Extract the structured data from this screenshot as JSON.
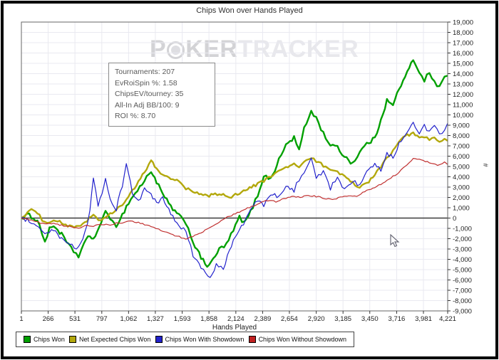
{
  "window": {
    "title": "Chips Won over Hands Played"
  },
  "watermark": {
    "part1": "P",
    "part2": "KER",
    "part3": "TRACKER",
    "chip_icon": "poker-chip"
  },
  "stats_box": {
    "lines": [
      "Tournaments: 207",
      "EvRoiSpin %: 1.58",
      "ChipsEV/tourney: 35",
      "All-In Adj BB/100: 9",
      "ROI %: 8.70"
    ]
  },
  "axes": {
    "x_title": "Hands Played",
    "y_unit_label": "#",
    "grid_color": "#e9e9f0",
    "zero_line_color": "#3c3c3c",
    "border_color": "#666666"
  },
  "legend": {
    "items": [
      {
        "label": "Chips Won",
        "color": "#00a000"
      },
      {
        "label": "Net Expected Chips Won",
        "color": "#b3a80c"
      },
      {
        "label": "Chips Won With Showdown",
        "color": "#2222cc"
      },
      {
        "label": "Chips Won Without Showdown",
        "color": "#c02020"
      }
    ]
  },
  "chart_data": {
    "type": "line",
    "title": "Chips Won over Hands Played",
    "xlabel": "Hands Played",
    "ylabel": "#",
    "xlim": [
      1,
      4221
    ],
    "ylim": [
      -9000,
      19000
    ],
    "y_step": 1000,
    "grid": true,
    "legend_position": "bottom",
    "x_ticks": [
      1,
      266,
      531,
      797,
      1062,
      1327,
      1593,
      1858,
      2124,
      2389,
      2654,
      2920,
      3185,
      3450,
      3716,
      3981,
      4221
    ],
    "series": [
      {
        "name": "Chips Won",
        "color": "#00a000",
        "width": 2.4,
        "points": [
          [
            1,
            0
          ],
          [
            60,
            300
          ],
          [
            120,
            100
          ],
          [
            180,
            -600
          ],
          [
            234,
            -2300
          ],
          [
            280,
            -1100
          ],
          [
            320,
            -700
          ],
          [
            400,
            -1600
          ],
          [
            470,
            -2700
          ],
          [
            567,
            -3700
          ],
          [
            620,
            -2500
          ],
          [
            680,
            -1700
          ],
          [
            714,
            -2000
          ],
          [
            770,
            -1100
          ],
          [
            834,
            900
          ],
          [
            880,
            -300
          ],
          [
            940,
            -700
          ],
          [
            1000,
            300
          ],
          [
            1062,
            1500
          ],
          [
            1150,
            2700
          ],
          [
            1220,
            3600
          ],
          [
            1285,
            4600
          ],
          [
            1340,
            3500
          ],
          [
            1400,
            2300
          ],
          [
            1480,
            1100
          ],
          [
            1560,
            200
          ],
          [
            1630,
            -400
          ],
          [
            1700,
            -2300
          ],
          [
            1780,
            -3900
          ],
          [
            1840,
            -4600
          ],
          [
            1900,
            -4100
          ],
          [
            1960,
            -3000
          ],
          [
            2030,
            -2600
          ],
          [
            2100,
            -1200
          ],
          [
            2160,
            100
          ],
          [
            2210,
            -500
          ],
          [
            2270,
            600
          ],
          [
            2340,
            2200
          ],
          [
            2400,
            4100
          ],
          [
            2470,
            3800
          ],
          [
            2550,
            5600
          ],
          [
            2620,
            7100
          ],
          [
            2700,
            7800
          ],
          [
            2750,
            6600
          ],
          [
            2800,
            8600
          ],
          [
            2870,
            10400
          ],
          [
            2920,
            9700
          ],
          [
            2990,
            8200
          ],
          [
            3060,
            7100
          ],
          [
            3130,
            6800
          ],
          [
            3200,
            6000
          ],
          [
            3280,
            5300
          ],
          [
            3350,
            6400
          ],
          [
            3420,
            7200
          ],
          [
            3500,
            7700
          ],
          [
            3560,
            9600
          ],
          [
            3620,
            11400
          ],
          [
            3680,
            10900
          ],
          [
            3740,
            12600
          ],
          [
            3800,
            13600
          ],
          [
            3880,
            15400
          ],
          [
            3940,
            14200
          ],
          [
            3990,
            13400
          ],
          [
            4040,
            14100
          ],
          [
            4090,
            13100
          ],
          [
            4140,
            12800
          ],
          [
            4190,
            13600
          ],
          [
            4221,
            13800
          ]
        ]
      },
      {
        "name": "Net Expected Chips Won",
        "color": "#b3a80c",
        "width": 2.4,
        "points": [
          [
            1,
            0
          ],
          [
            100,
            900
          ],
          [
            180,
            200
          ],
          [
            234,
            -500
          ],
          [
            320,
            -100
          ],
          [
            400,
            -500
          ],
          [
            480,
            -800
          ],
          [
            567,
            -900
          ],
          [
            650,
            -200
          ],
          [
            714,
            300
          ],
          [
            790,
            -300
          ],
          [
            860,
            200
          ],
          [
            940,
            800
          ],
          [
            1020,
            1500
          ],
          [
            1100,
            2600
          ],
          [
            1180,
            3800
          ],
          [
            1240,
            4800
          ],
          [
            1285,
            5600
          ],
          [
            1340,
            4700
          ],
          [
            1400,
            4200
          ],
          [
            1480,
            3900
          ],
          [
            1560,
            3500
          ],
          [
            1630,
            2900
          ],
          [
            1700,
            2500
          ],
          [
            1780,
            2300
          ],
          [
            1840,
            2100
          ],
          [
            1920,
            2400
          ],
          [
            2000,
            2200
          ],
          [
            2060,
            2000
          ],
          [
            2120,
            2300
          ],
          [
            2200,
            2600
          ],
          [
            2280,
            3000
          ],
          [
            2340,
            3300
          ],
          [
            2400,
            3600
          ],
          [
            2470,
            4100
          ],
          [
            2550,
            4500
          ],
          [
            2620,
            4900
          ],
          [
            2700,
            5200
          ],
          [
            2750,
            5000
          ],
          [
            2800,
            5400
          ],
          [
            2870,
            5800
          ],
          [
            2920,
            5500
          ],
          [
            2990,
            5100
          ],
          [
            3060,
            4800
          ],
          [
            3130,
            4400
          ],
          [
            3200,
            4000
          ],
          [
            3280,
            3400
          ],
          [
            3350,
            3000
          ],
          [
            3420,
            3300
          ],
          [
            3500,
            4200
          ],
          [
            3560,
            5000
          ],
          [
            3620,
            5800
          ],
          [
            3680,
            6600
          ],
          [
            3740,
            7300
          ],
          [
            3800,
            7900
          ],
          [
            3880,
            8300
          ],
          [
            3940,
            7700
          ],
          [
            3990,
            7900
          ],
          [
            4040,
            7500
          ],
          [
            4090,
            7800
          ],
          [
            4140,
            7300
          ],
          [
            4190,
            7600
          ],
          [
            4221,
            7500
          ]
        ]
      },
      {
        "name": "Chips Won With Showdown",
        "color": "#2222cc",
        "width": 1.2,
        "points": [
          [
            1,
            0
          ],
          [
            80,
            -300
          ],
          [
            150,
            -900
          ],
          [
            234,
            -1600
          ],
          [
            320,
            -1200
          ],
          [
            400,
            -2100
          ],
          [
            480,
            -2600
          ],
          [
            567,
            -2900
          ],
          [
            630,
            -1500
          ],
          [
            680,
            800
          ],
          [
            714,
            3700
          ],
          [
            760,
            1300
          ],
          [
            800,
            2200
          ],
          [
            834,
            3800
          ],
          [
            880,
            1800
          ],
          [
            940,
            900
          ],
          [
            1000,
            3200
          ],
          [
            1040,
            5300
          ],
          [
            1100,
            2400
          ],
          [
            1160,
            1600
          ],
          [
            1220,
            2800
          ],
          [
            1285,
            2300
          ],
          [
            1340,
            1400
          ],
          [
            1400,
            1900
          ],
          [
            1480,
            400
          ],
          [
            1560,
            -800
          ],
          [
            1630,
            -1300
          ],
          [
            1700,
            -3600
          ],
          [
            1780,
            -4800
          ],
          [
            1870,
            -5900
          ],
          [
            1930,
            -4600
          ],
          [
            2000,
            -4900
          ],
          [
            2060,
            -3000
          ],
          [
            2120,
            -1800
          ],
          [
            2200,
            -600
          ],
          [
            2270,
            900
          ],
          [
            2340,
            1700
          ],
          [
            2400,
            1200
          ],
          [
            2470,
            2400
          ],
          [
            2550,
            2000
          ],
          [
            2620,
            3100
          ],
          [
            2700,
            2700
          ],
          [
            2750,
            3800
          ],
          [
            2800,
            4300
          ],
          [
            2870,
            5700
          ],
          [
            2920,
            3900
          ],
          [
            2990,
            4400
          ],
          [
            3060,
            2900
          ],
          [
            3130,
            4100
          ],
          [
            3200,
            2700
          ],
          [
            3280,
            3600
          ],
          [
            3350,
            3100
          ],
          [
            3420,
            4400
          ],
          [
            3500,
            5200
          ],
          [
            3560,
            4700
          ],
          [
            3620,
            6300
          ],
          [
            3680,
            5900
          ],
          [
            3740,
            7200
          ],
          [
            3800,
            8100
          ],
          [
            3880,
            9400
          ],
          [
            3940,
            8200
          ],
          [
            3990,
            8900
          ],
          [
            4040,
            8300
          ],
          [
            4090,
            8800
          ],
          [
            4140,
            8100
          ],
          [
            4190,
            8500
          ],
          [
            4221,
            9200
          ]
        ]
      },
      {
        "name": "Chips Won Without Showdown",
        "color": "#c03030",
        "width": 1.2,
        "points": [
          [
            1,
            0
          ],
          [
            100,
            -200
          ],
          [
            234,
            -600
          ],
          [
            320,
            -500
          ],
          [
            400,
            -700
          ],
          [
            480,
            -850
          ],
          [
            567,
            -950
          ],
          [
            650,
            -700
          ],
          [
            714,
            -800
          ],
          [
            800,
            -600
          ],
          [
            880,
            -700
          ],
          [
            940,
            -500
          ],
          [
            1020,
            -400
          ],
          [
            1100,
            -300
          ],
          [
            1180,
            -500
          ],
          [
            1285,
            -800
          ],
          [
            1360,
            -1100
          ],
          [
            1440,
            -1400
          ],
          [
            1520,
            -1700
          ],
          [
            1630,
            -2000
          ],
          [
            1720,
            -1700
          ],
          [
            1800,
            -1300
          ],
          [
            1880,
            -900
          ],
          [
            1960,
            -400
          ],
          [
            2040,
            100
          ],
          [
            2120,
            400
          ],
          [
            2200,
            800
          ],
          [
            2280,
            1100
          ],
          [
            2360,
            1500
          ],
          [
            2440,
            1700
          ],
          [
            2520,
            1600
          ],
          [
            2600,
            1900
          ],
          [
            2680,
            2100
          ],
          [
            2760,
            2000
          ],
          [
            2840,
            2200
          ],
          [
            2920,
            2100
          ],
          [
            3000,
            1900
          ],
          [
            3080,
            1800
          ],
          [
            3160,
            2000
          ],
          [
            3240,
            2200
          ],
          [
            3320,
            2100
          ],
          [
            3400,
            2600
          ],
          [
            3480,
            2900
          ],
          [
            3560,
            3300
          ],
          [
            3640,
            3800
          ],
          [
            3720,
            4300
          ],
          [
            3800,
            5000
          ],
          [
            3880,
            5800
          ],
          [
            3960,
            5600
          ],
          [
            4040,
            5400
          ],
          [
            4120,
            5100
          ],
          [
            4190,
            5400
          ],
          [
            4221,
            5200
          ]
        ]
      }
    ]
  }
}
